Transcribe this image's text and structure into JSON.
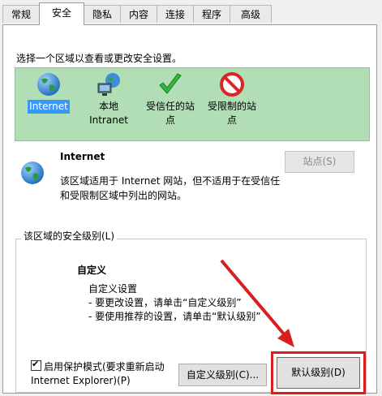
{
  "tabs": [
    "常规",
    "安全",
    "隐私",
    "内容",
    "连接",
    "程序",
    "高级"
  ],
  "zone_instruction": "选择一个区域以查看或更改安全设置。",
  "zones": [
    {
      "label": "Internet"
    },
    {
      "label": "本地\nIntranet"
    },
    {
      "label": "受信任的站\n点"
    },
    {
      "label": "受限制的站\n点"
    }
  ],
  "selected_zone": {
    "title": "Internet",
    "description": "该区域适用于 Internet 网站，但不适用于在受信任\n和受限制区域中列出的网站。",
    "sites_button": "站点(S)"
  },
  "security_level": {
    "group_label": "该区域的安全级别(L)",
    "level_name": "自定义",
    "level_description": "自定义设置\n - 要更改设置，请单击“自定义级别”\n - 要使用推荐的设置，请单击“默认级别”"
  },
  "protected_mode": {
    "label": "启用保护模式(要求重新启动\nInternet Explorer)(P)",
    "checked": true
  },
  "buttons": {
    "custom_level": "自定义级别(C)...",
    "default_level": "默认级别(D)"
  },
  "highlight_color": "#d81e1e"
}
